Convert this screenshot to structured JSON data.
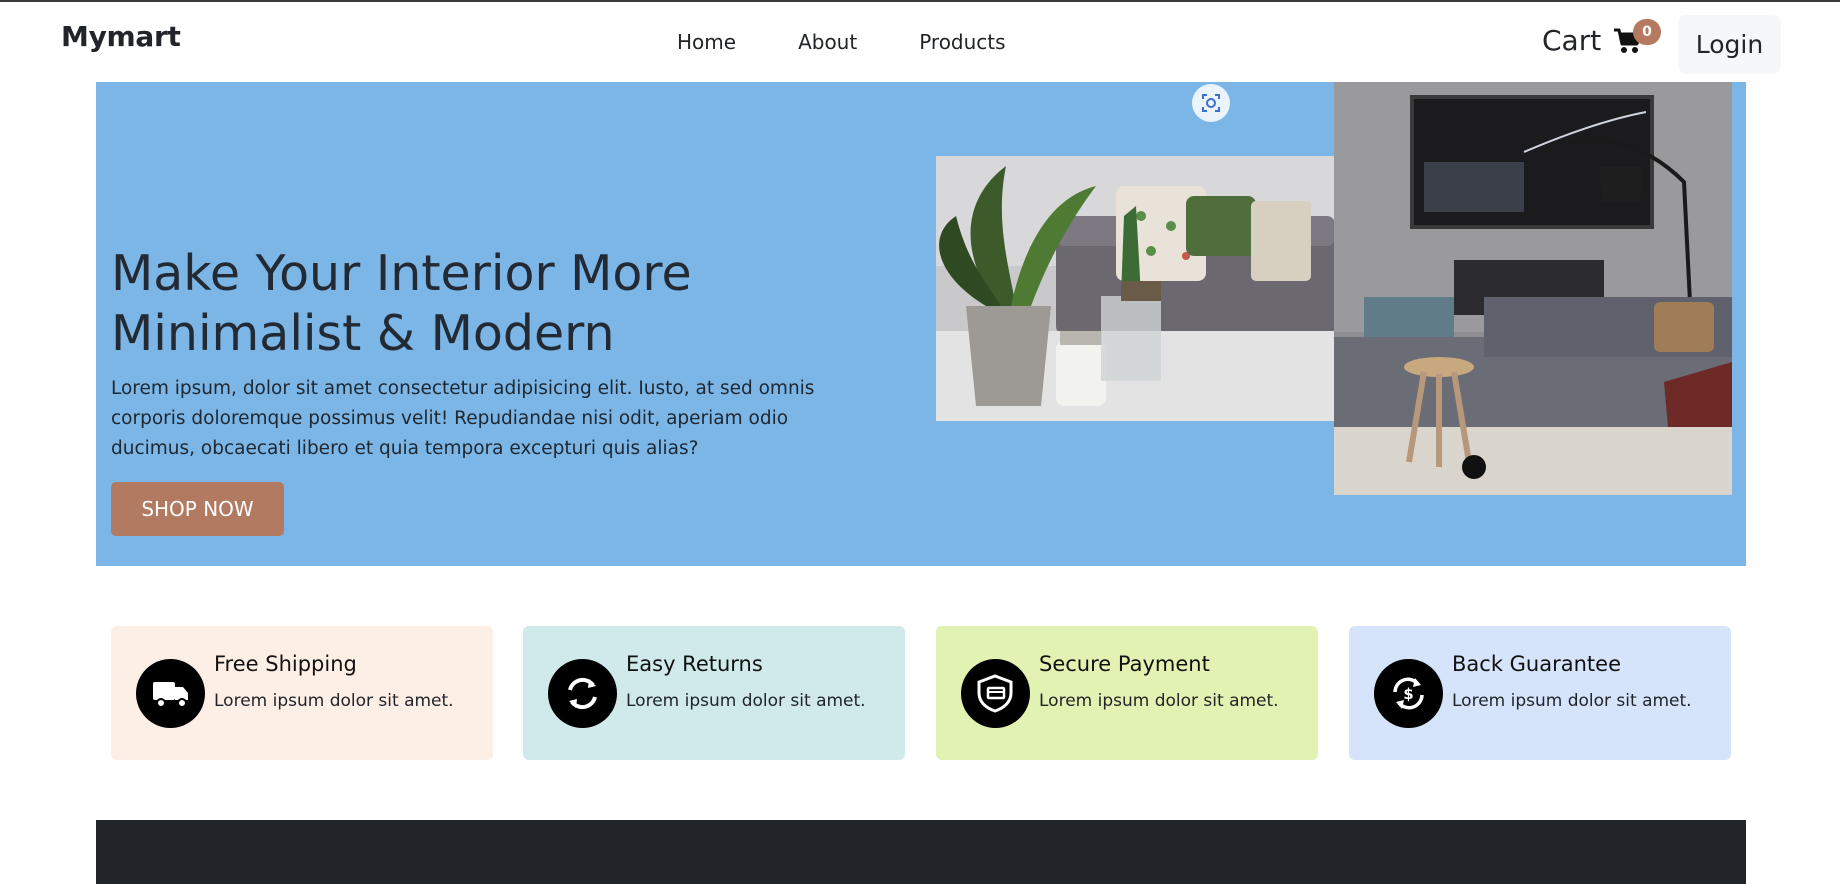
{
  "navbar": {
    "brand": "Mymart",
    "links": [
      "Home",
      "About",
      "Products"
    ],
    "cart_label": "Cart",
    "cart_count": "0",
    "login_label": "Login"
  },
  "hero": {
    "title": "Make Your Interior More Minimalist & Modern",
    "text": "Lorem ipsum, dolor sit amet consectetur adipisicing elit. Iusto, at sed omnis corporis doloremque possimus velit! Repudiandae nisi odit, aperiam odio ducimus, obcaecati libero et quia tempora excepturi quis alias?",
    "button_label": "SHOP NOW",
    "background": "#7bb6e7",
    "button_color": "#b37a62"
  },
  "features": [
    {
      "title": "Free Shipping",
      "desc": "Lorem ipsum dolor sit amet.",
      "icon": "truck-icon",
      "bg": "#fdeee6"
    },
    {
      "title": "Easy Returns",
      "desc": "Lorem ipsum dolor sit amet.",
      "icon": "refresh-icon",
      "bg": "#d0e9ea"
    },
    {
      "title": "Secure Payment",
      "desc": "Lorem ipsum dolor sit amet.",
      "icon": "shield-icon",
      "bg": "#e2f2b2"
    },
    {
      "title": "Back Guarantee",
      "desc": "Lorem ipsum dolor sit amet.",
      "icon": "money-back-icon",
      "bg": "#d5e4fb"
    }
  ],
  "colors": {
    "badge": "#b57a61",
    "footer": "#212529"
  }
}
